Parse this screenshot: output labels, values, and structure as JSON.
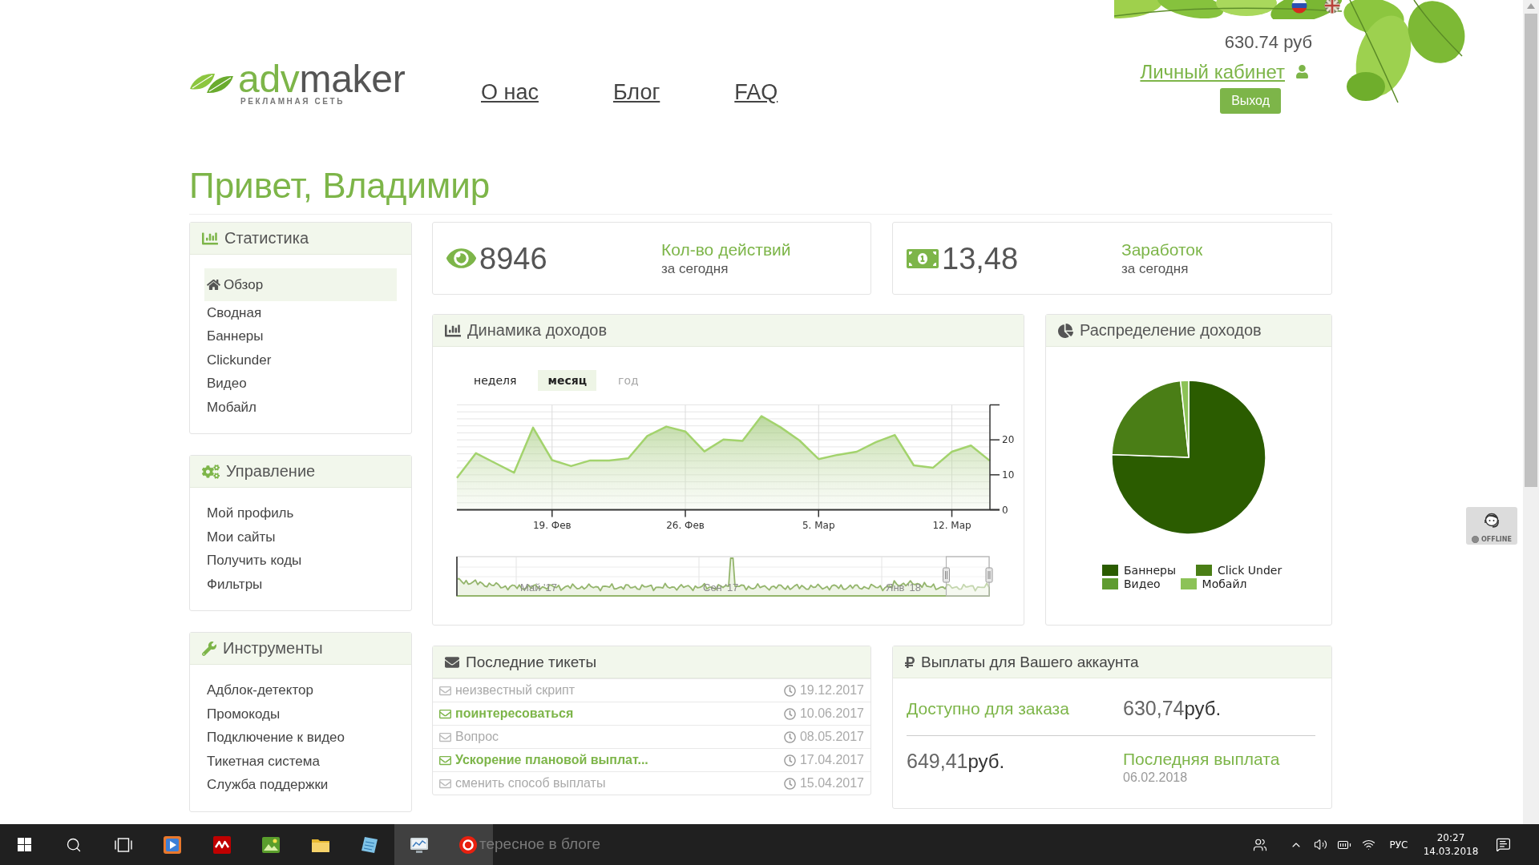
{
  "header": {
    "logo": {
      "word_start": "adv",
      "word_end": "maker",
      "tagline": "РЕКЛАМНАЯ СЕТЬ"
    },
    "nav": [
      "О нас",
      "Блог",
      "FAQ"
    ],
    "balance": "630.74 руб",
    "account_link": "Личный кабинет",
    "logout_button": "Выход"
  },
  "greeting": "Привет, Владимир",
  "sidebar": [
    {
      "title": "Статистика",
      "items": [
        {
          "label": "Обзор",
          "selected": true
        },
        {
          "label": "Сводная",
          "selected": false
        },
        {
          "label": "Баннеры",
          "selected": false
        },
        {
          "label": "Clickunder",
          "selected": false
        },
        {
          "label": "Видео",
          "selected": false
        },
        {
          "label": "Мобайл",
          "selected": false
        }
      ]
    },
    {
      "title": "Управление",
      "items": [
        {
          "label": "Мой профиль",
          "selected": false
        },
        {
          "label": "Мои сайты",
          "selected": false
        },
        {
          "label": "Получить коды",
          "selected": false
        },
        {
          "label": "Фильтры",
          "selected": false
        }
      ]
    },
    {
      "title": "Инструменты",
      "items": [
        {
          "label": "Адблок-детектор",
          "selected": false
        },
        {
          "label": "Промокоды",
          "selected": false
        },
        {
          "label": "Подключение к видео",
          "selected": false
        },
        {
          "label": "Тикетная система",
          "selected": false
        },
        {
          "label": "Служба поддержки",
          "selected": false
        }
      ]
    }
  ],
  "stats": [
    {
      "value": "8946",
      "metric": "Кол-во действий",
      "period": "за сегодня"
    },
    {
      "value": "13,48",
      "metric": "Заработок",
      "period": "за сегодня"
    }
  ],
  "income_chart": {
    "title": "Динамика доходов",
    "tabs": [
      {
        "label": "неделя",
        "selected": false,
        "disabled": false
      },
      {
        "label": "месяц",
        "selected": true,
        "disabled": false
      },
      {
        "label": "год",
        "selected": false,
        "disabled": true
      }
    ],
    "chart_data": {
      "type": "area",
      "categories": [
        null,
        null,
        null,
        null,
        null,
        "19. Фев",
        null,
        null,
        null,
        null,
        null,
        null,
        "26. Фев",
        null,
        null,
        null,
        null,
        null,
        null,
        "5. Мар",
        null,
        null,
        null,
        null,
        null,
        null,
        "12. Мар",
        null,
        null
      ],
      "series": [
        {
          "values": [
            9.1,
            16.2,
            13.4,
            10.6,
            23.5,
            14.2,
            12.5,
            14.1,
            14.1,
            14.7,
            21.1,
            23.8,
            22.4,
            16.7,
            20.1,
            19.7,
            26.8,
            23.6,
            19.8,
            14.5,
            15.7,
            16.6,
            19.3,
            21.4,
            12.7,
            12.0,
            16.6,
            18.4,
            14.0
          ]
        }
      ],
      "ylim": [
        0,
        30
      ],
      "yticks": [
        0,
        10,
        20
      ],
      "grid": true
    },
    "navigator_labels": [
      "Май '17",
      "Сен '17",
      "Янв '18"
    ]
  },
  "income_distribution": {
    "title": "Распределение доходов",
    "legend": [
      {
        "label": "Баннеры",
        "color": "#2b5c00"
      },
      {
        "label": "Click Under",
        "color": "#4a7e16"
      },
      {
        "label": "Видео",
        "color": "#5f9c30"
      },
      {
        "label": "Мобайл",
        "color": "#8cc257"
      }
    ]
  },
  "tickets": {
    "title": "Последние тикеты",
    "rows": [
      {
        "subject": "неизвестный скрипт",
        "date": "19.12.2017",
        "unread": false
      },
      {
        "subject": "поинтересоваться",
        "date": "10.06.2017",
        "unread": true
      },
      {
        "subject": "Вопрос",
        "date": "08.05.2017",
        "unread": false
      },
      {
        "subject": "Ускорение плановой выплат...",
        "date": "17.04.2017",
        "unread": true
      },
      {
        "subject": "сменить способ выплаты",
        "date": "15.04.2017",
        "unread": false
      }
    ]
  },
  "payouts": {
    "title": "Выплаты для Вашего аккаунта",
    "available_label": "Доступно для заказа",
    "available_amount": "630,74**руб.**",
    "paid_amount": "649,41**руб.**",
    "last_payout_label": "Последняя выплата",
    "last_payout_date": "06.02.2018"
  },
  "chat_widget": {
    "status": "OFFLINE"
  },
  "hidden_panel_title": "тересное в блоге",
  "taskbar": {
    "apps": [
      {
        "active": false
      },
      {
        "active": false
      },
      {
        "active": false
      },
      {
        "active": false
      },
      {
        "active": false
      },
      {
        "active": true
      },
      {
        "active": true
      }
    ],
    "language": "РУС",
    "time": "20:27",
    "date": "14.03.2018"
  }
}
